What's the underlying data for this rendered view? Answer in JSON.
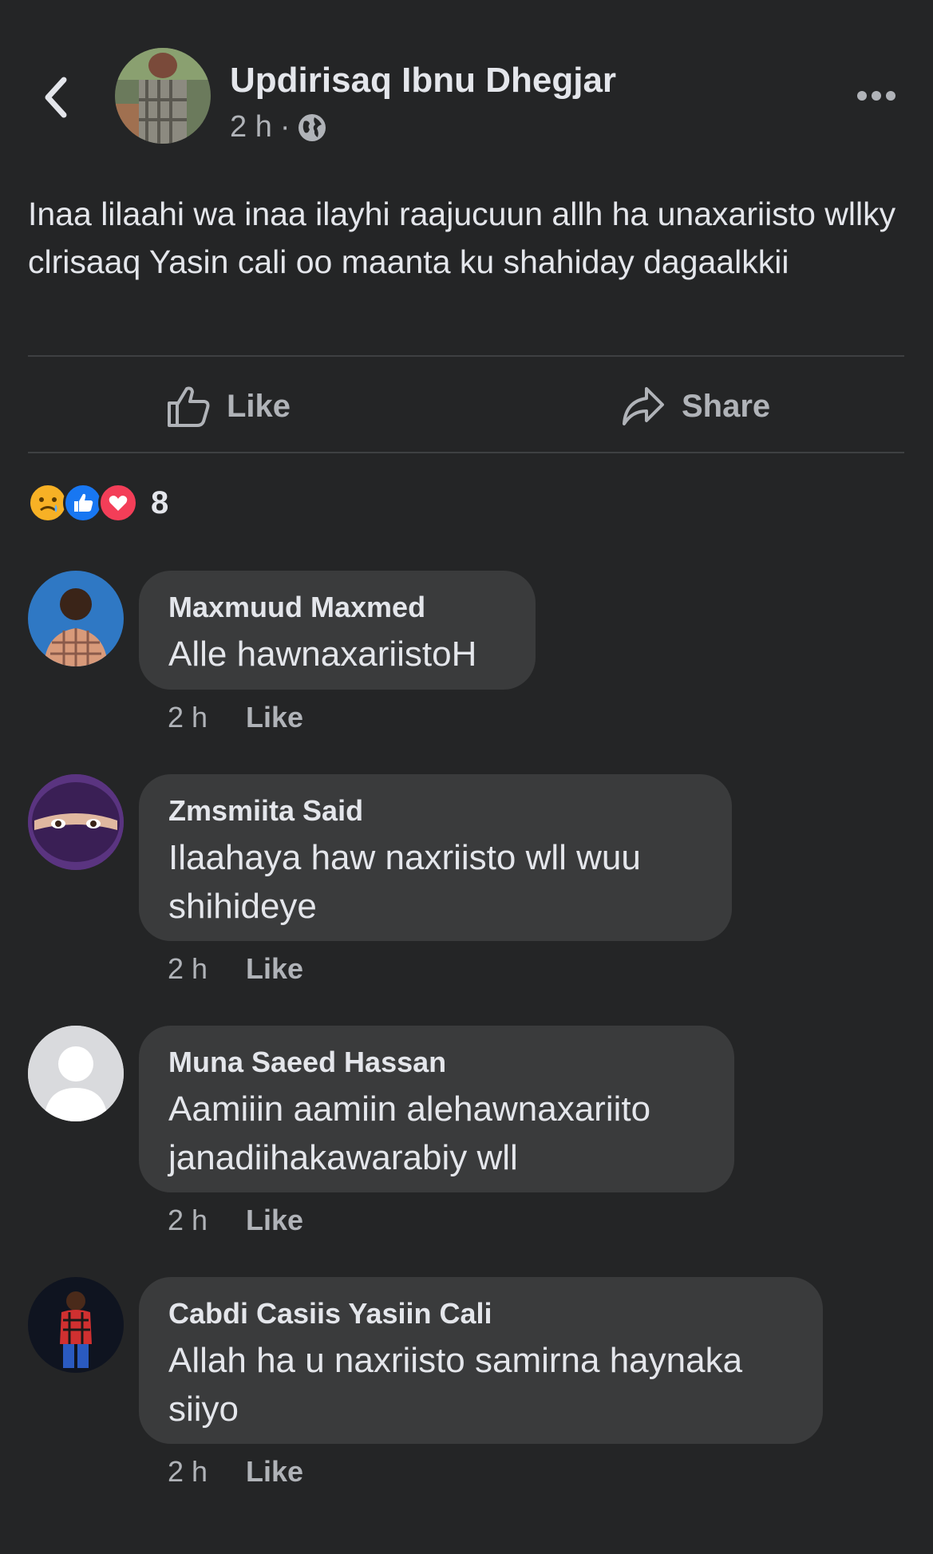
{
  "post": {
    "author": "Updirisaq Ibnu Dhegjar",
    "time": "2 h",
    "separator": "·",
    "privacy_icon": "globe-icon",
    "text": "Inaa lilaahi wa inaa ilayhi raajucuun allh ha unaxariisto wllky clrisaaq  Yasin cali oo maanta ku shahiday dagaalkkii"
  },
  "actions": {
    "like_label": "Like",
    "share_label": "Share"
  },
  "reactions": {
    "icons": [
      "sad-icon",
      "like-icon",
      "love-icon"
    ],
    "count": "8"
  },
  "comments": [
    {
      "name": "Maxmuud Maxmed",
      "text": "Alle hawnaxariistoH",
      "time": "2 h",
      "like_label": "Like"
    },
    {
      "name": "Zmsmiita Said",
      "text": "Ilaahaya haw naxriisto wll   wuu shihideye",
      "time": "2 h",
      "like_label": "Like"
    },
    {
      "name": "Muna Saeed Hassan",
      "text": "Aamiiin aamiin  alehawnaxariito janadiihakawarabiy wll",
      "time": "2 h",
      "like_label": "Like"
    },
    {
      "name": "Cabdi Casiis Yasiin Cali",
      "text": "Allah ha u naxriisto samirna haynaka siiyo",
      "time": "2 h",
      "like_label": "Like"
    }
  ],
  "colors": {
    "background": "#242526",
    "bubble": "#3a3b3c",
    "primary_text": "#e4e6eb",
    "secondary_text": "#b0b3b8",
    "like_blue": "#1877f2",
    "love_red": "#f33e58",
    "sad_yellow": "#f7b125"
  }
}
